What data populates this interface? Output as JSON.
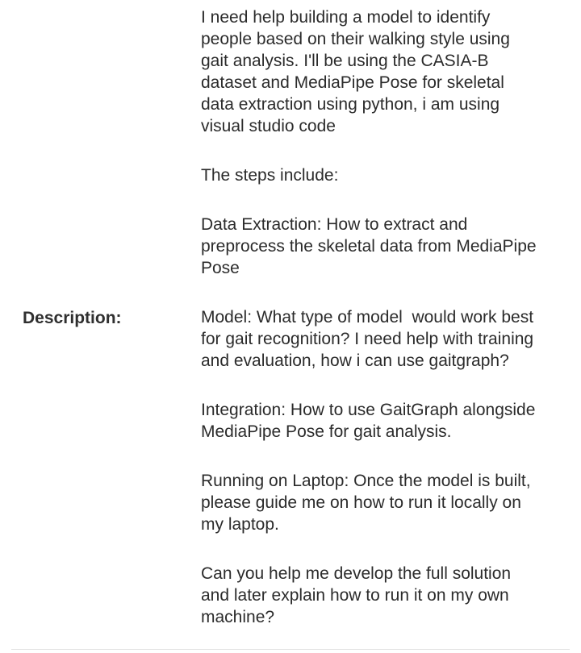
{
  "field": {
    "label": "Description:",
    "paragraphs": [
      "I need help building a model to identify\npeople based on their walking style using\ngait analysis. I'll be using the CASIA-B\ndataset and MediaPipe Pose for skeletal\ndata extraction using python, i am using\nvisual studio code",
      "The steps include:",
      "Data Extraction: How to extract and\npreprocess the skeletal data from MediaPipe\nPose",
      "Model: What type of model  would work best\nfor gait recognition? I need help with training\nand evaluation, how i can use gaitgraph?",
      "Integration: How to use GaitGraph alongside\nMediaPipe Pose for gait analysis.",
      "Running on Laptop: Once the model is built,\nplease guide me on how to run it locally on\nmy laptop.",
      "Can you help me develop the full solution\nand later explain how to run it on my own\nmachine?"
    ]
  }
}
